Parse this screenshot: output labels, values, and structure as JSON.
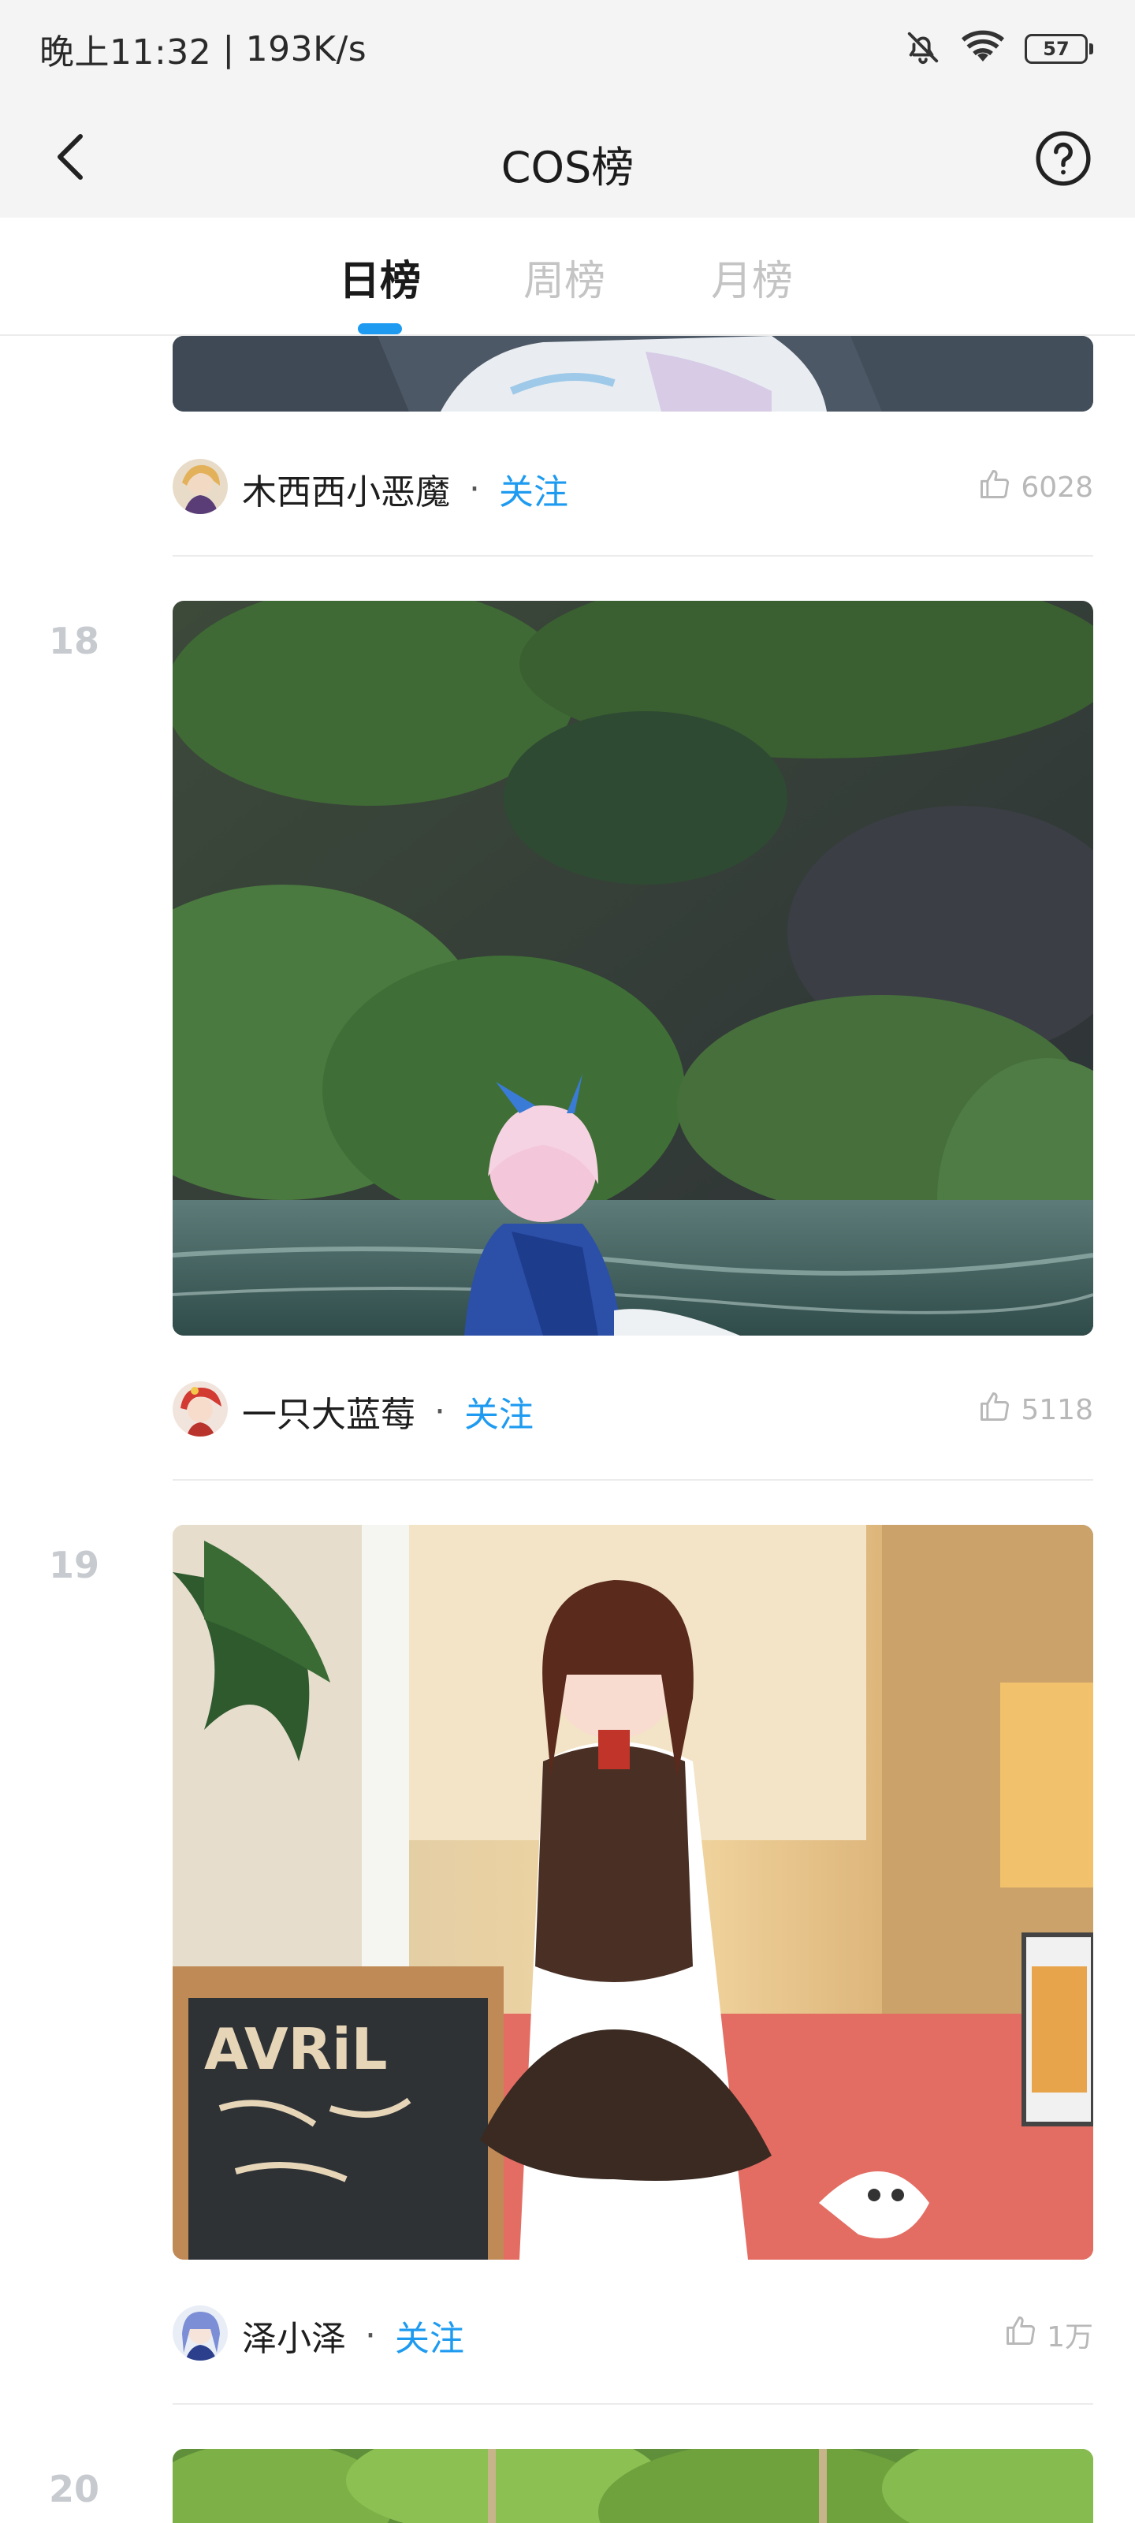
{
  "status_bar": {
    "time": "晚上11:32",
    "separator": "|",
    "speed": "193K/s",
    "battery": "57"
  },
  "nav": {
    "title": "COS榜"
  },
  "tabs": [
    {
      "label": "日榜",
      "active": true
    },
    {
      "label": "周榜",
      "active": false
    },
    {
      "label": "月榜",
      "active": false
    }
  ],
  "dot": "·",
  "follow_label": "关注",
  "posts": [
    {
      "rank": "",
      "author": "木西西小恶魔",
      "likes": "6028"
    },
    {
      "rank": "18",
      "author": "一只大蓝莓",
      "likes": "5118"
    },
    {
      "rank": "19",
      "author": "泽小泽",
      "likes": "1万"
    },
    {
      "rank": "20",
      "author": "",
      "likes": ""
    }
  ],
  "icons": {
    "back": "chevron-left-icon",
    "help": "question-circle-icon",
    "mute": "bell-off-icon",
    "wifi": "wifi-icon",
    "like": "thumb-up-icon"
  },
  "colors": {
    "accent": "#1e9bf0",
    "rank": "#c7cbd0",
    "bar_bg": "#f4f4f4"
  }
}
